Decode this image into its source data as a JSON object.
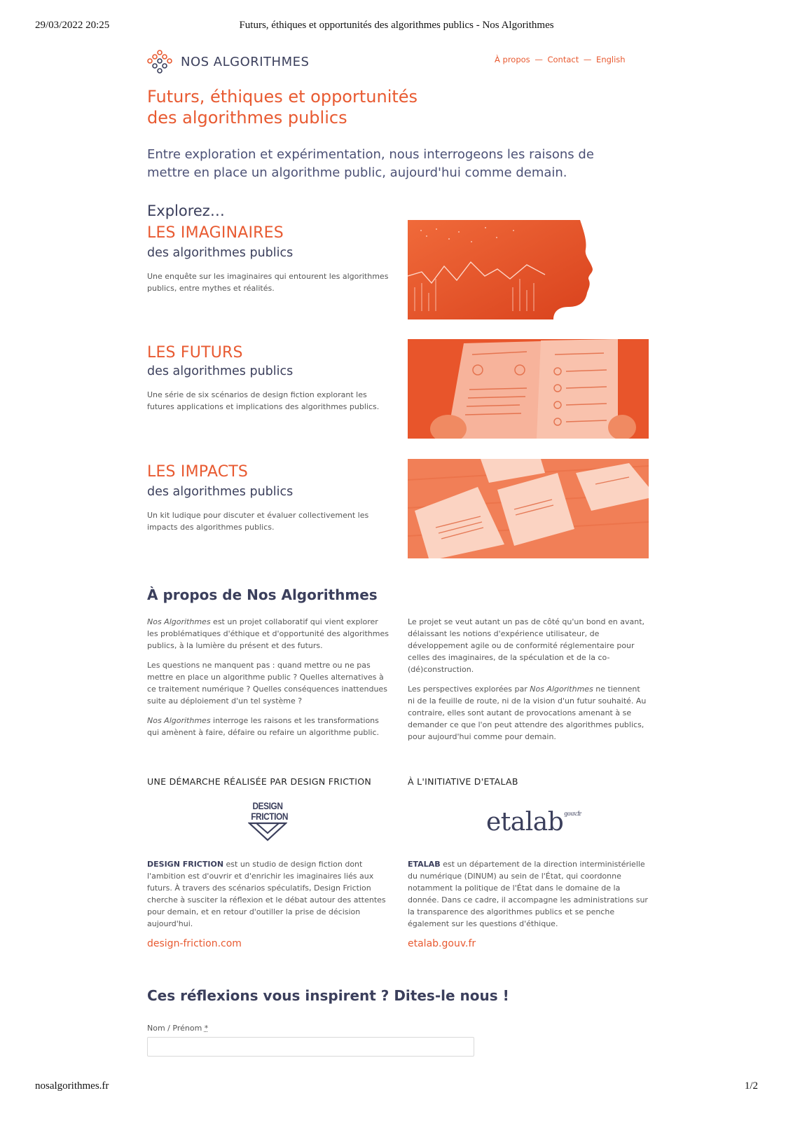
{
  "print": {
    "datetime": "29/03/2022 20:25",
    "doc_title": "Futurs, éthiques et opportunités des algorithmes publics - Nos Algorithmes",
    "url": "nosalgorithmes.fr",
    "page_counter": "1/2"
  },
  "header": {
    "logo_text": "NOS ALGORITHMES",
    "nav": [
      {
        "label": "À propos"
      },
      {
        "label": "Contact"
      },
      {
        "label": "English"
      }
    ],
    "nav_separator": "—"
  },
  "hero": {
    "title_line1": "Futurs, éthiques et opportunités",
    "title_line2": "des algorithmes publics",
    "subtitle": "Entre exploration et expérimentation, nous interrogeons les raisons de mettre en place un algorithme public, aujourd'hui comme demain."
  },
  "explore": {
    "label": "Explorez…",
    "sections": [
      {
        "title": "LES IMAGINAIRES",
        "subtitle": "des algorithmes publics",
        "description": "Une enquête sur les imaginaires qui entourent les algorithmes publics, entre mythes et réalités.",
        "image": "head-silhouette-data-visual"
      },
      {
        "title": "LES FUTURS",
        "subtitle": "des algorithmes publics",
        "description": "Une série de six scénarios de design fiction explorant les futures applications et implications des algorithmes publics.",
        "image": "printed-leaflet-in-hands"
      },
      {
        "title": "LES IMPACTS",
        "subtitle": "des algorithmes publics",
        "description": "Un kit ludique pour discuter et évaluer collectivement les impacts des algorithmes publics.",
        "image": "game-cards-on-table"
      }
    ]
  },
  "about": {
    "title": "À propos de Nos Algorithmes",
    "left": [
      {
        "em": "Nos Algorithmes",
        "text": " est un projet collaboratif qui vient explorer les problématiques d'éthique et d'opportunité des algorithmes publics, à la lumière du présent et des futurs."
      },
      {
        "em": "",
        "text": "Les questions ne manquent pas : quand mettre ou ne pas mettre en place un algorithme public ? Quelles alternatives à ce traitement numérique ? Quelles conséquences inattendues suite au déploiement d'un tel système ?"
      },
      {
        "em": "Nos Algorithmes",
        "text": " interroge les raisons et les transformations qui amènent à faire, défaire ou refaire un algorithme public."
      }
    ],
    "right_p1": "Le projet se veut autant un pas de côté qu'un bond en avant, délaissant les notions d'expérience utilisateur, de développement agile ou de conformité réglementaire pour celles des imaginaires, de la spéculation et de la co-(dé)construction.",
    "right_p2_before": "Les perspectives explorées par ",
    "right_p2_em": "Nos Algorithmes",
    "right_p2_after": " ne tiennent ni de la feuille de route, ni de la vision d'un futur souhaité. Au contraire, elles sont autant de provocations amenant à se demander ce que l'on peut attendre des algorithmes publics, pour aujourd'hui comme pour demain."
  },
  "partners": {
    "design_friction": {
      "label": "UNE DÉMARCHE RÉALISÉE PAR DESIGN FRICTION",
      "logo_line1": "DESIGN",
      "logo_line2": "FRICTION",
      "name": "DESIGN FRICTION",
      "text": " est un studio de design fiction dont l'ambition est d'ouvrir et d'enrichir les imaginaires liés aux futurs. À travers des scénarios spéculatifs, Design Friction cherche à susciter la réflexion et le débat autour des attentes pour demain, et en retour d'outiller la prise de décision aujourd'hui.",
      "link": "design-friction.com"
    },
    "etalab": {
      "label": "À L'INITIATIVE D'ETALAB",
      "logo_text": "etalab",
      "logo_sup": "gouv.fr",
      "name": "ETALAB",
      "text": " est un département de la direction interministérielle du numérique (DINUM) au sein de l'État, qui coordonne notamment la politique de l'État dans le domaine de la donnée. Dans ce cadre, il accompagne les administrations sur la transparence des algorithmes publics et se penche également sur les questions d'éthique.",
      "link": "etalab.gouv.fr"
    }
  },
  "contact": {
    "title": "Ces réflexions vous inspirent ? Dites-le nous !",
    "name_label": "Nom / Prénom ",
    "required_mark": "*",
    "name_value": ""
  },
  "colors": {
    "accent": "#e85a31",
    "navy": "#3b3f5c"
  }
}
